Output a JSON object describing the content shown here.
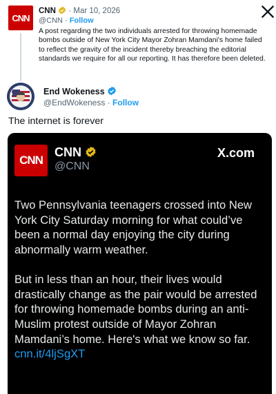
{
  "quoted_post": {
    "logo_text": "CNN",
    "name": "CNN",
    "separator": "·",
    "date": "Mar 10, 2026",
    "handle": "@CNN",
    "follow_label": "Follow",
    "text": "A post regarding the two individuals arrested for throwing homemade bombs outside of New York City Mayor Zohran Mamdani's home failed to reflect the gravity of the incident thereby breaching the editorial standards we require for all our reporting. It has therefore been deleted.",
    "close_icon": "x-logo-icon"
  },
  "post": {
    "name": "End Wokeness",
    "handle": "@EndWokeness",
    "separator": "·",
    "follow_label": "Follow",
    "text": "The internet is forever"
  },
  "embedded_screenshot": {
    "logo_text": "CNN",
    "name": "CNN",
    "handle": "@CNN",
    "watermark": "X.com",
    "paragraph1": "Two Pennsylvania teenagers crossed into New York City Saturday morning for what could’ve been a normal day enjoying the city during abnormally warm weather.",
    "paragraph2": "But in less than an hour, their lives would drastically change as the pair would be arrested for throwing homemade bombs during an anti-Muslim protest outside of Mayor Zohran Mamdani’s home. Here's what we know so far. ",
    "link": "cnn.it/4ljSgXT"
  },
  "colors": {
    "cnn_red": "#cc0000",
    "verified_gold": "#e2b719",
    "verified_blue": "#1d9bf0",
    "link_blue": "#1d9bf0"
  }
}
